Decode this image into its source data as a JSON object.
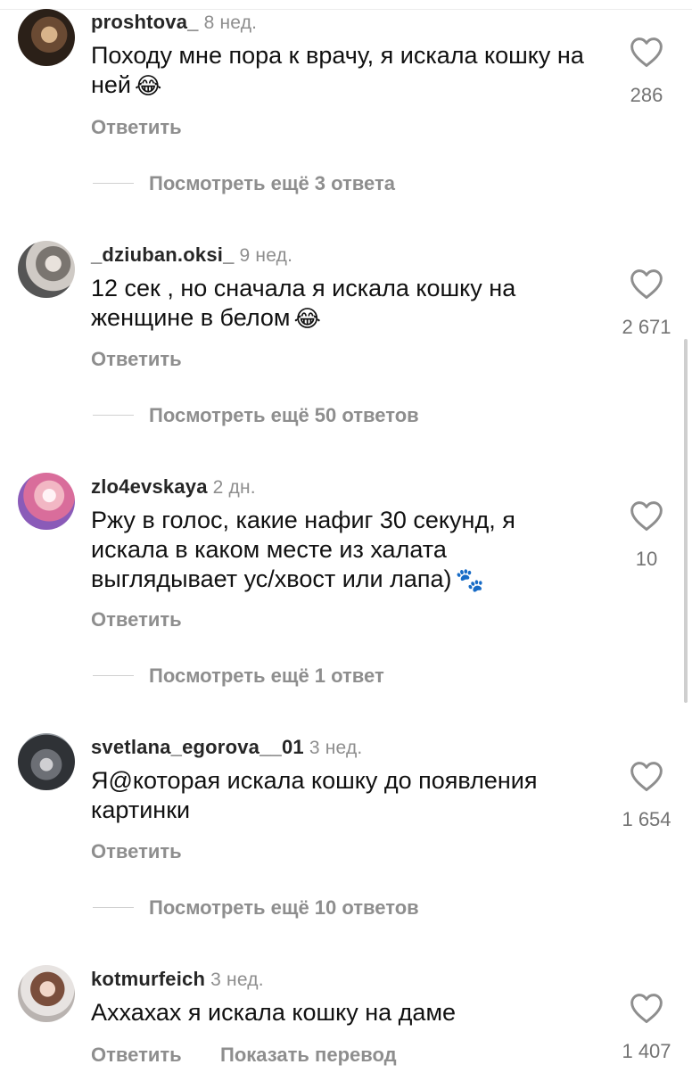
{
  "comments": [
    {
      "username": "proshtova_",
      "time": "8 нед.",
      "text": "Походу мне пора к врачу, я искала кошку на ней",
      "emoji": "😂",
      "likes": "286",
      "reply_label": "Ответить",
      "more_replies": "Посмотреть ещё 3 ответа"
    },
    {
      "username": "_dziuban.oksi_",
      "time": "9 нед.",
      "text": "12 сек , но сначала я искала кошку на женщине в белом",
      "emoji": "😂",
      "likes": "2 671",
      "reply_label": "Ответить",
      "more_replies": "Посмотреть ещё 50 ответов"
    },
    {
      "username": "zlo4evskaya",
      "time": "2 дн.",
      "text": "Ржу в голос, какие нафиг 30 секунд, я искала в каком месте из халата выглядывает ус/хвост или лапа)",
      "emoji": "🐾",
      "likes": "10",
      "reply_label": "Ответить",
      "more_replies": "Посмотреть ещё 1 ответ"
    },
    {
      "username": "svetlana_egorova__01",
      "time": "3 нед.",
      "text": "Я@которая искала кошку до появления картинки",
      "emoji": "",
      "likes": "1 654",
      "reply_label": "Ответить",
      "more_replies": "Посмотреть ещё 10 ответов"
    },
    {
      "username": "kotmurfeich",
      "time": "3 нед.",
      "text": "Аххахах я искала кошку на даме",
      "emoji": "",
      "likes": "1 407",
      "reply_label": "Ответить",
      "translate_label": "Показать перевод"
    }
  ],
  "icons": {
    "like": "heart-outline-icon"
  },
  "colors": {
    "secondary_text": "#8e8e8e",
    "primary_text": "#111111",
    "background": "#ffffff"
  }
}
